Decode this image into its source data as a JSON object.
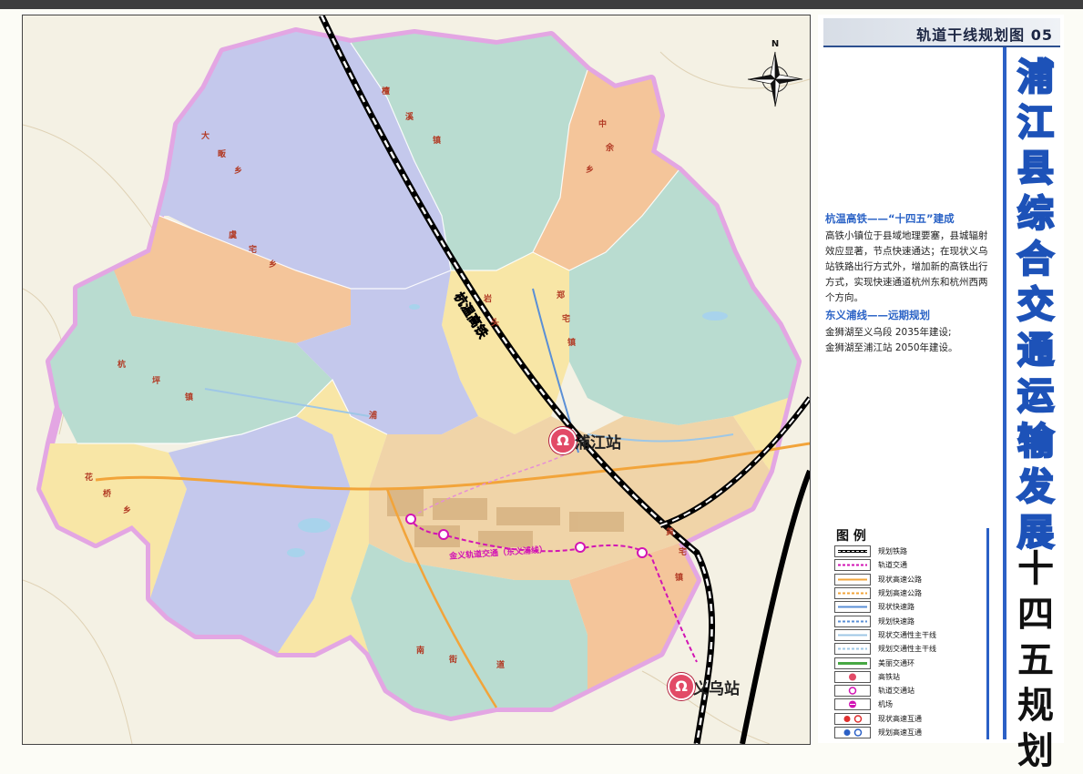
{
  "header": {
    "sheet_title": "轨道干线规划图",
    "sheet_number": "05",
    "main_title_chars": [
      "浦",
      "江",
      "县",
      "综",
      "合",
      "交",
      "通",
      "运",
      "输",
      "发",
      "展"
    ],
    "sub_title_chars": [
      "十",
      "四",
      "五",
      "规",
      "划"
    ]
  },
  "compass": {
    "north_label": "N"
  },
  "map": {
    "stations": {
      "pujiang": "浦江站",
      "yiwu": "义乌站"
    },
    "rail_line_label": "杭温高铁",
    "metro_line_label": "金义轨道交通（东义浦线）",
    "region_chars": [
      {
        "text": "大"
      },
      {
        "text": "畈"
      },
      {
        "text": "乡"
      },
      {
        "text": "虞"
      },
      {
        "text": "宅"
      },
      {
        "text": "乡"
      },
      {
        "text": "杭"
      },
      {
        "text": "坪"
      },
      {
        "text": "镇"
      },
      {
        "text": "花"
      },
      {
        "text": "桥"
      },
      {
        "text": "乡"
      },
      {
        "text": "檀"
      },
      {
        "text": "溪"
      },
      {
        "text": "镇"
      },
      {
        "text": "中"
      },
      {
        "text": "余"
      },
      {
        "text": "乡"
      },
      {
        "text": "郑"
      },
      {
        "text": "宅"
      },
      {
        "text": "镇"
      },
      {
        "text": "黄"
      },
      {
        "text": "宅"
      },
      {
        "text": "镇"
      },
      {
        "text": "浦"
      },
      {
        "text": "南"
      },
      {
        "text": "街"
      },
      {
        "text": "道"
      },
      {
        "text": "岩"
      },
      {
        "text": "头"
      }
    ]
  },
  "sections": [
    {
      "heading": "杭温高铁——“十四五”建成",
      "body": "高铁小镇位于县域地理要塞，县城辐射效应显著，节点快速通达；在现状义乌站铁路出行方式外，增加新的高铁出行方式，实现快速通道杭州东和杭州西两个方向。"
    },
    {
      "heading": "东义浦线——远期规划",
      "body": "金狮湖至义乌段 2035年建设;\n金狮湖至浦江站 2050年建设。"
    }
  ],
  "legend": {
    "title": "图 例",
    "items": [
      {
        "label": "规划铁路",
        "symbol": "planned-rail"
      },
      {
        "label": "轨道交通",
        "symbol": "metro"
      },
      {
        "label": "现状高速公路",
        "symbol": "highway-existing",
        "color": "#f2a43a"
      },
      {
        "label": "规划高速公路",
        "symbol": "highway-planned",
        "color": "#f2a43a"
      },
      {
        "label": "现状快速路",
        "symbol": "expressway-existing",
        "color": "#5a8fd6"
      },
      {
        "label": "规划快速路",
        "symbol": "expressway-planned",
        "color": "#5a8fd6"
      },
      {
        "label": "现状交通性主干线",
        "symbol": "arterial-existing",
        "color": "#9ec7e6"
      },
      {
        "label": "规划交通性主干线",
        "symbol": "arterial-planned",
        "color": "#9ec7e6"
      },
      {
        "label": "美丽交通环",
        "symbol": "scenic-ring",
        "color": "#47a843"
      },
      {
        "label": "高铁站",
        "symbol": "hsr-station"
      },
      {
        "label": "轨道交通站",
        "symbol": "metro-station"
      },
      {
        "label": "机场",
        "symbol": "airport"
      },
      {
        "label": "现状高速互通",
        "symbol": "interchange-existing"
      },
      {
        "label": "规划高速互通",
        "symbol": "interchange-planned"
      }
    ]
  },
  "colors": {
    "accent_blue": "#2b60c6",
    "station_red": "#e24a67",
    "metro_magenta": "#d214b4",
    "region_purple": "#c4c8ec",
    "region_green": "#b9dcd0",
    "region_orange": "#f4c59a",
    "region_yellow": "#f8e6a6",
    "boundary": "#d27bd6"
  }
}
